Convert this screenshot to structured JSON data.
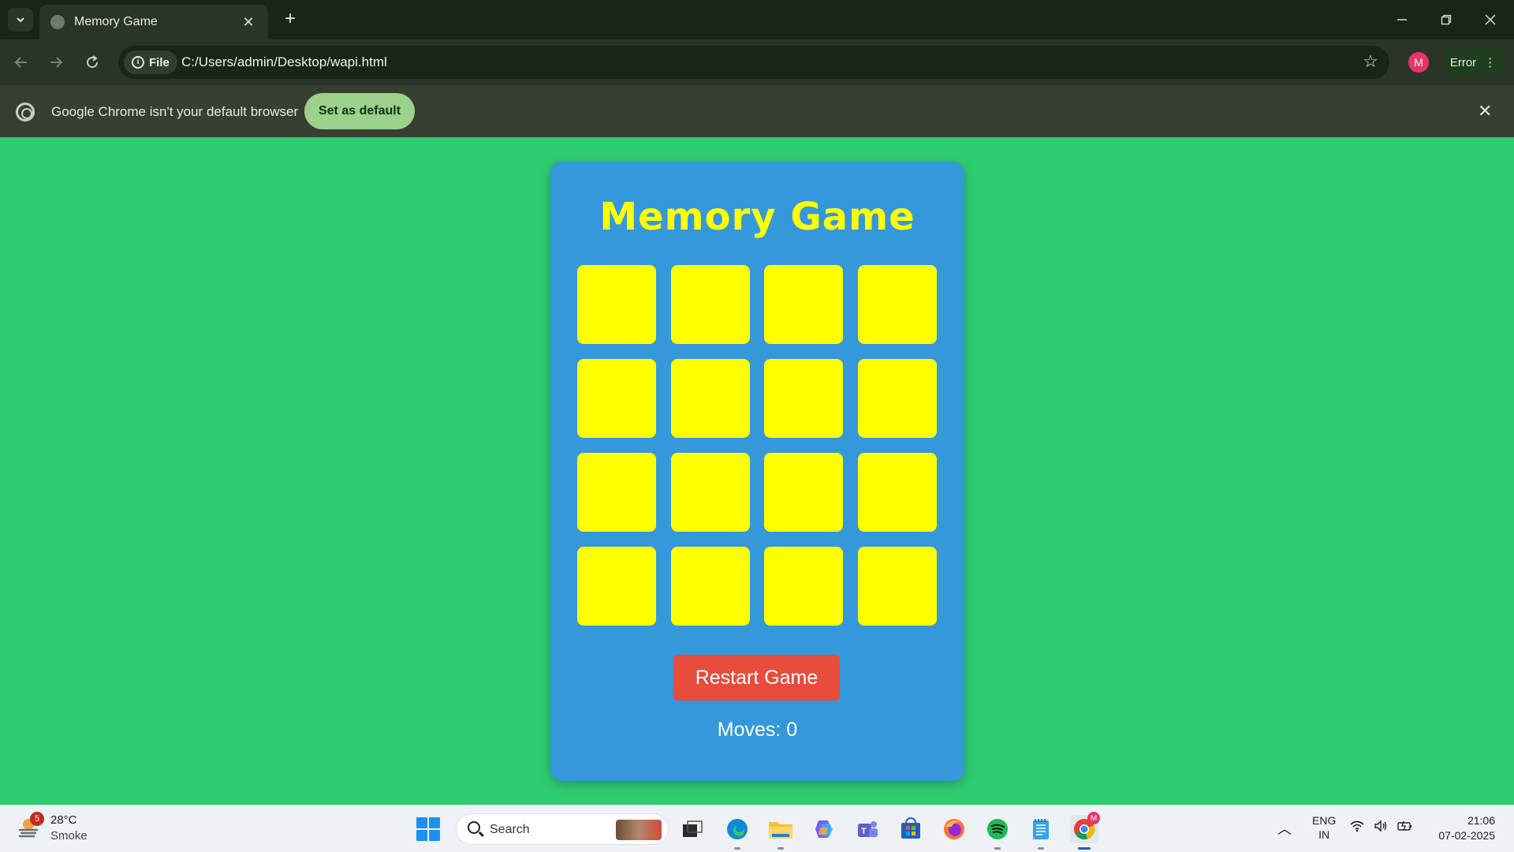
{
  "browser": {
    "tab_title": "Memory Game",
    "new_tab_symbol": "+",
    "url_chip_label": "File",
    "url": "C:/Users/admin/Desktop/wapi.html",
    "profile_initial": "M",
    "error_label": "Error"
  },
  "infobar": {
    "message": "Google Chrome isn't your default browser",
    "button_label": "Set as default"
  },
  "game": {
    "title": "Memory Game",
    "cards": 16,
    "restart_label": "Restart Game",
    "moves_text": "Moves: 0",
    "colors": {
      "page_bg": "#2ecc71",
      "card_panel": "#3498db",
      "title": "#ffff00",
      "tile": "#ffff00",
      "restart_button": "#e74c3c"
    }
  },
  "taskbar": {
    "weather_badge": "5",
    "temperature": "28°C",
    "condition": "Smoke",
    "search_label": "Search",
    "lang_line1": "ENG",
    "lang_line2": "IN",
    "time": "21:06",
    "date": "07-02-2025",
    "chrome_badge": "M",
    "apps": [
      "task-view-icon",
      "edge-icon",
      "file-explorer-icon",
      "copilot-icon",
      "teams-icon",
      "store-icon",
      "firefox-icon",
      "spotify-icon",
      "notepad-icon",
      "chrome-icon"
    ]
  }
}
